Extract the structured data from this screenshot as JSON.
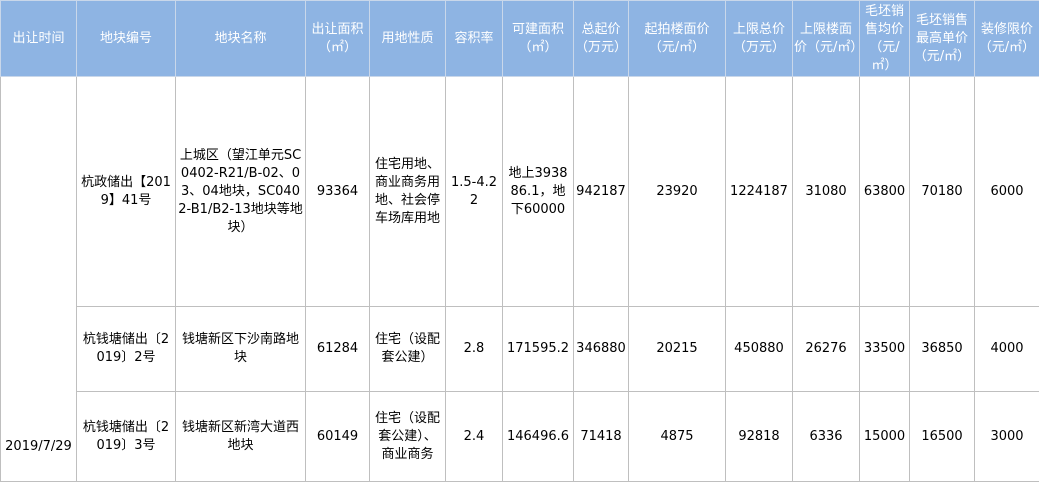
{
  "table": {
    "headers": [
      "出让时间",
      "地块编号",
      "地块名称",
      "出让面积（㎡）",
      "用地性质",
      "容积率",
      "可建面积（㎡）",
      "总起价（万元）",
      "起拍楼面价（元/㎡）",
      "上限总价（万元）",
      "上限楼面价（元/㎡）",
      "毛坯销售均价（元/㎡）",
      "毛坯销售最高单价（元/㎡）",
      "装修限价（元/㎡）"
    ],
    "date": "2019/7/29",
    "rows": [
      {
        "code": "杭政储出【2019】41号",
        "name": "上城区（望江单元SC0402-R21/B-02、03、04地块，SC0402-B1/B2-13地块等地块）",
        "area": "93364",
        "use": "住宅用地、商业商务用地、社会停车场库用地",
        "far": "1.5-4.22",
        "buildable": "地上393886.1，地下60000",
        "start_total": "942187",
        "start_floor": "23920",
        "cap_total": "1224187",
        "cap_floor": "31080",
        "avg_price": "63800",
        "max_price": "70180",
        "deco": "6000"
      },
      {
        "code": "杭钱塘储出〔2019〕2号",
        "name": "钱塘新区下沙南路地块",
        "area": "61284",
        "use": "住宅（设配套公建）",
        "far": "2.8",
        "buildable": "171595.2",
        "start_total": "346880",
        "start_floor": "20215",
        "cap_total": "450880",
        "cap_floor": "26276",
        "avg_price": "33500",
        "max_price": "36850",
        "deco": "4000"
      },
      {
        "code": "杭钱塘储出〔2019〕3号",
        "name": "钱塘新区新湾大道西地块",
        "area": "60149",
        "use": "住宅（设配套公建）、商业商务",
        "far": "2.4",
        "buildable": "146496.6",
        "start_total": "71418",
        "start_floor": "4875",
        "cap_total": "92818",
        "cap_floor": "6336",
        "avg_price": "15000",
        "max_price": "16500",
        "deco": "3000"
      }
    ]
  }
}
